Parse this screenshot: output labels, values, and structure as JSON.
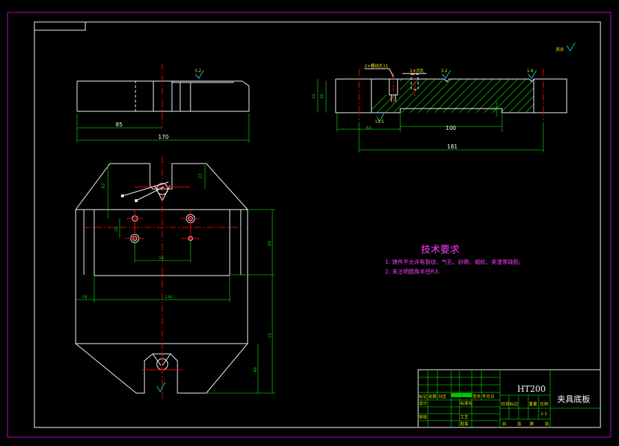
{
  "drawing": {
    "colors": {
      "background": "#000000",
      "outline": "#ffffff",
      "centerline": "#ff0000",
      "dimension": "#00c800",
      "border": "#d000d0",
      "note": "#ff40ff"
    },
    "front_view": {
      "dims": {
        "d85": "85",
        "d170": "170"
      },
      "roughness": "3.2"
    },
    "section_view": {
      "dims": {
        "d32": "32",
        "d30": "30",
        "d64": "64",
        "d100": "100",
        "d181": "181",
        "d12": "12"
      },
      "notes": {
        "thread": "2×螺纹孔11",
        "counterbore": "2×沉孔",
        "ra_left": "3.2",
        "ra_right": "1.6",
        "ra_bottom": "12.5"
      }
    },
    "plan_view": {
      "dims": {
        "d82": "82",
        "d23": "23",
        "d20": "20",
        "d55": "55",
        "d86": "86",
        "d18": "18",
        "d134": "134",
        "d15": "15",
        "d49": "49"
      }
    },
    "corner_symbol": "其余",
    "technical_requirements": {
      "title": "技术要求",
      "items": [
        "1. 铸件不允许有裂纹、气孔、砂眼、缩松、夹渣等缺陷;",
        "2. 未注明圆角半径R3."
      ]
    },
    "title_block": {
      "material": "HT200",
      "part_name": "夹具底板",
      "scale": "1:1",
      "labels": [
        "标记",
        "处数",
        "分区",
        "更改文件号",
        "签名",
        "年月日",
        "设计",
        "标准化",
        "审核",
        "工艺",
        "批准",
        "阶段标记",
        "重量",
        "比例",
        "共",
        "张",
        "第",
        "张"
      ]
    }
  }
}
